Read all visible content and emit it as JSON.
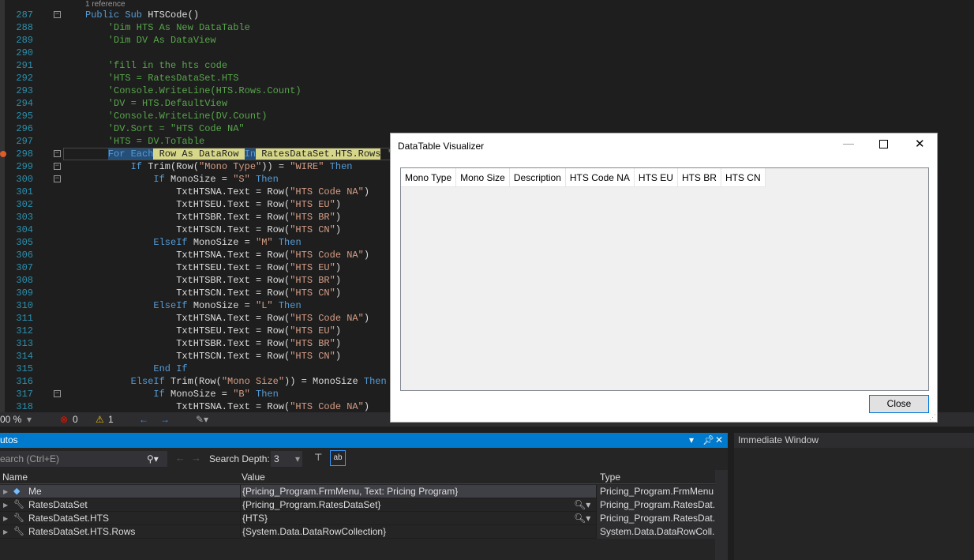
{
  "editor": {
    "reference_lens": "1 reference",
    "lines": [
      {
        "num": "287",
        "fold": true,
        "indent": 0,
        "t": [
          [
            "kw",
            "Public Sub "
          ],
          [
            "",
            "HTSCode()"
          ]
        ]
      },
      {
        "num": "288",
        "indent": 1,
        "t": [
          [
            "cm",
            "'Dim HTS As New DataTable"
          ]
        ]
      },
      {
        "num": "289",
        "indent": 1,
        "t": [
          [
            "cm",
            "'Dim DV As DataView"
          ]
        ]
      },
      {
        "num": "290",
        "indent": 1,
        "t": []
      },
      {
        "num": "291",
        "indent": 1,
        "t": [
          [
            "cm",
            "'fill in the hts code"
          ]
        ]
      },
      {
        "num": "292",
        "indent": 1,
        "t": [
          [
            "cm",
            "'HTS = RatesDataSet.HTS"
          ]
        ]
      },
      {
        "num": "293",
        "indent": 1,
        "t": [
          [
            "cm",
            "'Console.WriteLine(HTS.Rows.Count)"
          ]
        ]
      },
      {
        "num": "294",
        "indent": 1,
        "t": [
          [
            "cm",
            "'DV = HTS.DefaultView"
          ]
        ]
      },
      {
        "num": "295",
        "indent": 1,
        "t": [
          [
            "cm",
            "'Console.WriteLine(DV.Count)"
          ]
        ]
      },
      {
        "num": "296",
        "indent": 1,
        "t": [
          [
            "cm",
            "'DV.Sort = \"HTS Code NA\""
          ]
        ]
      },
      {
        "num": "297",
        "indent": 1,
        "t": [
          [
            "cm",
            "'HTS = DV.ToTable"
          ]
        ]
      },
      {
        "num": "298",
        "fold": true,
        "bp": true,
        "current": true,
        "indent": 1,
        "t": [
          [
            "hlk",
            "For Each"
          ],
          [
            "hl",
            " Row As DataRow "
          ],
          [
            "hlk",
            "In"
          ],
          [
            "hl",
            " RatesDataSet.HTS.Rows"
          ],
          [
            "cm",
            " 'H"
          ]
        ]
      },
      {
        "num": "299",
        "fold": true,
        "indent": 2,
        "t": [
          [
            "kw",
            "If "
          ],
          [
            "",
            "Trim(Row("
          ],
          [
            "str",
            "\"Mono Type\""
          ],
          [
            "",
            "))"
          ],
          [
            "",
            " = "
          ],
          [
            "str",
            "\"WIRE\""
          ],
          [
            "kw",
            " Then"
          ]
        ]
      },
      {
        "num": "300",
        "fold": true,
        "indent": 3,
        "t": [
          [
            "kw",
            "If "
          ],
          [
            "",
            "MonoSize = "
          ],
          [
            "str",
            "\"S\""
          ],
          [
            "kw",
            " Then"
          ]
        ]
      },
      {
        "num": "301",
        "indent": 4,
        "t": [
          [
            "",
            "TxtHTSNA.Text = Row("
          ],
          [
            "str",
            "\"HTS Code NA\""
          ],
          [
            "",
            ")"
          ]
        ]
      },
      {
        "num": "302",
        "indent": 4,
        "t": [
          [
            "",
            "TxtHTSEU.Text = Row("
          ],
          [
            "str",
            "\"HTS EU\""
          ],
          [
            "",
            ")"
          ]
        ]
      },
      {
        "num": "303",
        "indent": 4,
        "t": [
          [
            "",
            "TxtHTSBR.Text = Row("
          ],
          [
            "str",
            "\"HTS BR\""
          ],
          [
            "",
            ")"
          ]
        ]
      },
      {
        "num": "304",
        "indent": 4,
        "t": [
          [
            "",
            "TxtHTSCN.Text = Row("
          ],
          [
            "str",
            "\"HTS CN\""
          ],
          [
            "",
            ")"
          ]
        ]
      },
      {
        "num": "305",
        "indent": 3,
        "t": [
          [
            "kw",
            "ElseIf "
          ],
          [
            "",
            "MonoSize = "
          ],
          [
            "str",
            "\"M\""
          ],
          [
            "kw",
            " Then"
          ]
        ]
      },
      {
        "num": "306",
        "indent": 4,
        "t": [
          [
            "",
            "TxtHTSNA.Text = Row("
          ],
          [
            "str",
            "\"HTS Code NA\""
          ],
          [
            "",
            ")"
          ]
        ]
      },
      {
        "num": "307",
        "indent": 4,
        "t": [
          [
            "",
            "TxtHTSEU.Text = Row("
          ],
          [
            "str",
            "\"HTS EU\""
          ],
          [
            "",
            ")"
          ]
        ]
      },
      {
        "num": "308",
        "indent": 4,
        "t": [
          [
            "",
            "TxtHTSBR.Text = Row("
          ],
          [
            "str",
            "\"HTS BR\""
          ],
          [
            "",
            ")"
          ]
        ]
      },
      {
        "num": "309",
        "indent": 4,
        "t": [
          [
            "",
            "TxtHTSCN.Text = Row("
          ],
          [
            "str",
            "\"HTS CN\""
          ],
          [
            "",
            ")"
          ]
        ]
      },
      {
        "num": "310",
        "indent": 3,
        "t": [
          [
            "kw",
            "ElseIf "
          ],
          [
            "",
            "MonoSize = "
          ],
          [
            "str",
            "\"L\""
          ],
          [
            "kw",
            " Then"
          ]
        ]
      },
      {
        "num": "311",
        "indent": 4,
        "t": [
          [
            "",
            "TxtHTSNA.Text = Row("
          ],
          [
            "str",
            "\"HTS Code NA\""
          ],
          [
            "",
            ")"
          ]
        ]
      },
      {
        "num": "312",
        "indent": 4,
        "t": [
          [
            "",
            "TxtHTSEU.Text = Row("
          ],
          [
            "str",
            "\"HTS EU\""
          ],
          [
            "",
            ")"
          ]
        ]
      },
      {
        "num": "313",
        "indent": 4,
        "t": [
          [
            "",
            "TxtHTSBR.Text = Row("
          ],
          [
            "str",
            "\"HTS BR\""
          ],
          [
            "",
            ")"
          ]
        ]
      },
      {
        "num": "314",
        "indent": 4,
        "t": [
          [
            "",
            "TxtHTSCN.Text = Row("
          ],
          [
            "str",
            "\"HTS CN\""
          ],
          [
            "",
            ")"
          ]
        ]
      },
      {
        "num": "315",
        "indent": 3,
        "t": [
          [
            "kw",
            "End If"
          ]
        ]
      },
      {
        "num": "316",
        "indent": 2,
        "t": [
          [
            "kw",
            "ElseIf "
          ],
          [
            "",
            "Trim(Row("
          ],
          [
            "str",
            "\"Mono Size\""
          ],
          [
            "",
            ")) = MonoSize "
          ],
          [
            "kw",
            "Then"
          ]
        ]
      },
      {
        "num": "317",
        "fold": true,
        "indent": 3,
        "t": [
          [
            "kw",
            "If "
          ],
          [
            "",
            "MonoSize = "
          ],
          [
            "str",
            "\"B\""
          ],
          [
            "kw",
            " Then"
          ]
        ]
      },
      {
        "num": "318",
        "indent": 4,
        "t": [
          [
            "",
            "TxtHTSNA.Text = Row("
          ],
          [
            "str",
            "\"HTS Code NA\""
          ],
          [
            "",
            ")"
          ]
        ]
      }
    ]
  },
  "status": {
    "zoom": "00 %",
    "errors": "0",
    "warnings": "1"
  },
  "autos": {
    "title": "utos",
    "search_placeholder": "earch (Ctrl+E)",
    "search_depth_label": "Search Depth:",
    "search_depth": "3",
    "columns": [
      "Name",
      "Value",
      "Type"
    ],
    "rows": [
      {
        "name": "Me",
        "value": "{Pricing_Program.FrmMenu, Text: Pricing Program}",
        "type": "Pricing_Program.FrmMenu",
        "icon": "object-icon"
      },
      {
        "name": "RatesDataSet",
        "value": "{Pricing_Program.RatesDataSet}",
        "type": "Pricing_Program.RatesDat...",
        "icon": "property-icon",
        "viz": true
      },
      {
        "name": "RatesDataSet.HTS",
        "value": "{HTS}",
        "type": "Pricing_Program.RatesDat...",
        "icon": "wrench-icon",
        "viz": true
      },
      {
        "name": "RatesDataSet.HTS.Rows",
        "value": "{System.Data.DataRowCollection}",
        "type": "System.Data.DataRowColl...",
        "icon": "wrench-icon"
      }
    ]
  },
  "immediate": {
    "title": "Immediate Window"
  },
  "dialog": {
    "title": "DataTable Visualizer",
    "columns": [
      "Mono Type",
      "Mono Size",
      "Description",
      "HTS Code NA",
      "HTS EU",
      "HTS BR",
      "HTS CN"
    ],
    "close_label": "Close"
  },
  "colors": {
    "accent": "#007acc",
    "keyword": "#569cd6",
    "string": "#d69d85",
    "comment": "#57a64a",
    "line_number": "#2b91af"
  }
}
